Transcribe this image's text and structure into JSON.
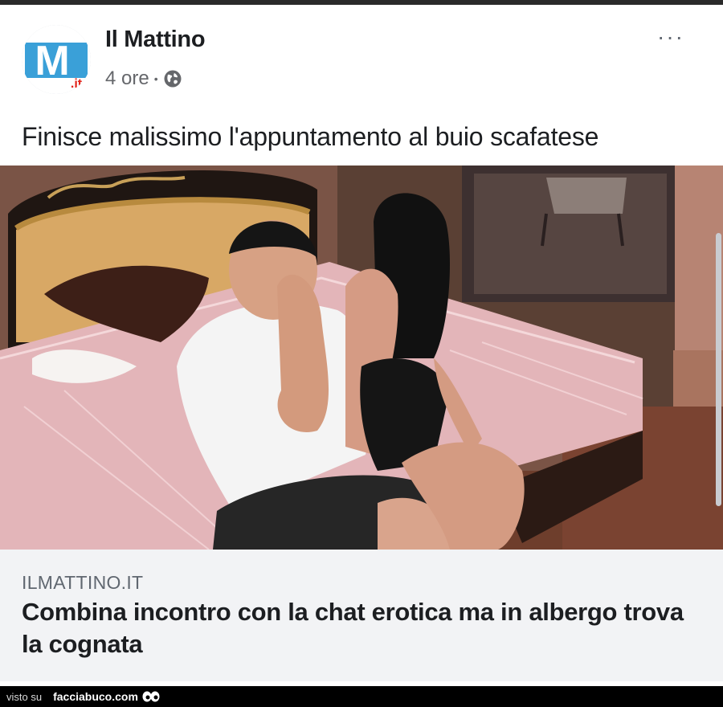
{
  "post": {
    "page_name": "Il Mattino",
    "time": "4 ore",
    "separator": "•",
    "audience_icon": "globe-icon",
    "more_label": "···",
    "caption": "Finisce malissimo l'appuntamento al buio scafatese"
  },
  "avatar": {
    "logo_letter": "M",
    "logo_suffix": ".it"
  },
  "link_preview": {
    "domain": "ILMATTINO.IT",
    "headline": "Combina incontro con la chat erotica ma in albergo trova la cognata"
  },
  "footer": {
    "visto_su": "visto su",
    "site": "facciabuco.com"
  },
  "colors": {
    "text": "#1c1e21",
    "secondary": "#65676b",
    "link_box": "#f2f3f5",
    "logo_blue": "#3aa0d8"
  }
}
